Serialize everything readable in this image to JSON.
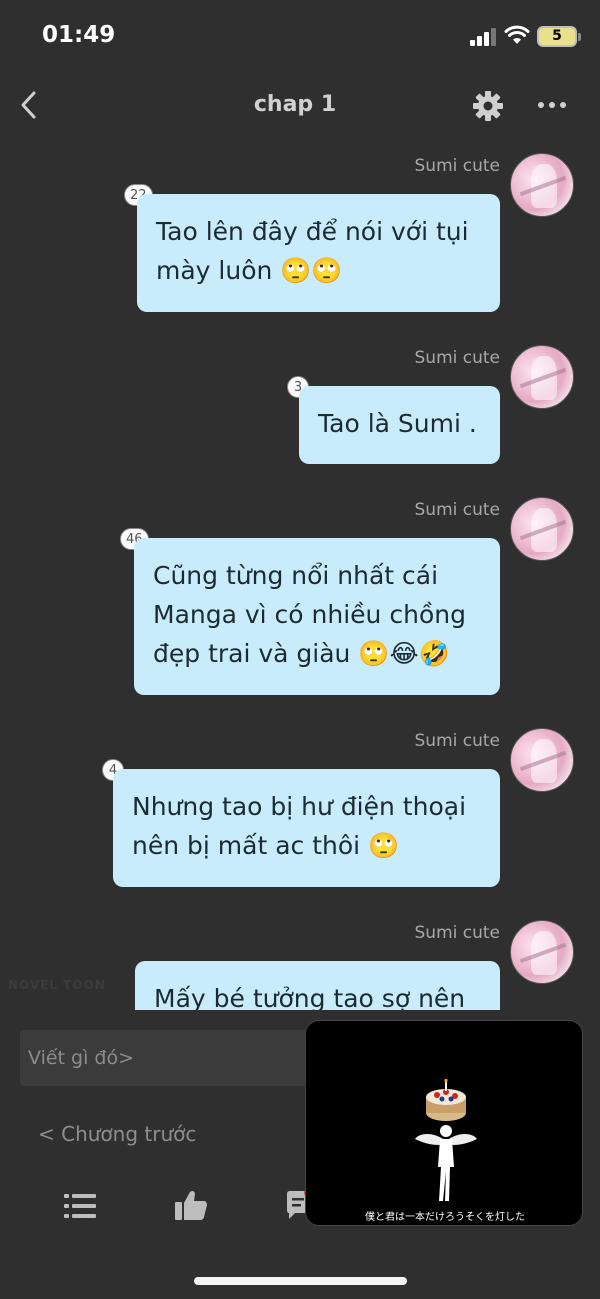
{
  "status_bar": {
    "time": "01:49",
    "battery": "5",
    "icons": [
      "signal-icon",
      "wifi-icon",
      "battery-icon"
    ]
  },
  "header": {
    "title": "chap 1",
    "icons": [
      "back-icon",
      "gear-icon",
      "more-icon"
    ]
  },
  "messages": [
    {
      "sender": "Sumi cute",
      "count": "22",
      "text_lines": [
        "Tao lên đây để nói với tụi",
        "mày luôn 🙄🙄"
      ]
    },
    {
      "sender": "Sumi cute",
      "count": "3",
      "text_lines": [
        "Tao là Sumi ."
      ]
    },
    {
      "sender": "Sumi cute",
      "count": "46",
      "text_lines": [
        "Cũng từng nổi nhất cái",
        "Manga vì có nhiều chồng",
        "đẹp trai và giàu 🙄😂🤣"
      ]
    },
    {
      "sender": "Sumi cute",
      "count": "4",
      "text_lines": [
        "Nhưng tao bị hư điện thoại",
        "nên bị mất ac thôi 🙄"
      ]
    },
    {
      "sender": "Sumi cute",
      "count": "",
      "text_lines": [
        "Mấy bé tưởng tao sợ nên"
      ]
    }
  ],
  "input": {
    "placeholder": "Viết gì đó>"
  },
  "navigation": {
    "previous_chapter": "< Chương trước"
  },
  "toolbar": {
    "icons": [
      "list-icon",
      "like-icon",
      "comment-icon"
    ]
  },
  "watermark": "NOVEL TOON",
  "video_overlay": {
    "caption": "僕と君は一本だけろうそくを灯した"
  },
  "colors": {
    "background": "#2f2f2f",
    "bubble": "#c9ecfc",
    "bubble_text": "#1c2b33",
    "sender_name": "#a8a8a8"
  }
}
